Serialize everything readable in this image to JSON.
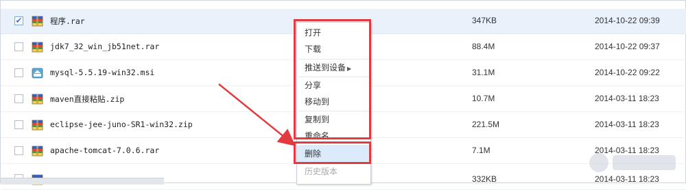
{
  "files": [
    {
      "name": "程序.rar",
      "size": "347KB",
      "date": "2014-10-22 09:39",
      "icon": "rar-archive-icon",
      "selected": true
    },
    {
      "name": "jdk7_32_win_jb51net.rar",
      "size": "88.4M",
      "date": "2014-10-22 09:37",
      "icon": "rar-archive-icon",
      "selected": false
    },
    {
      "name": "mysql-5.5.19-win32.msi",
      "size": "31.1M",
      "date": "2014-10-22 09:22",
      "icon": "msi-installer-icon",
      "selected": false
    },
    {
      "name": "maven直接粘贴.zip",
      "size": "10.7M",
      "date": "2014-03-11 18:23",
      "icon": "zip-archive-icon",
      "selected": false
    },
    {
      "name": "eclipse-jee-juno-SR1-win32.zip",
      "size": "221.5M",
      "date": "2014-03-11 18:23",
      "icon": "zip-archive-icon",
      "selected": false
    },
    {
      "name": "apache-tomcat-7.0.6.rar",
      "size": "7.1M",
      "date": "2014-03-11 18:23",
      "icon": "rar-archive-icon",
      "selected": false
    },
    {
      "name": "",
      "size": "332KB",
      "date": "2014-03-11 18:23",
      "icon": "rar-archive-icon",
      "selected": false
    }
  ],
  "context_menu": {
    "items": [
      {
        "label": "打开",
        "enabled": true
      },
      {
        "label": "下载",
        "enabled": true
      },
      {
        "label": "推送到设备",
        "enabled": true,
        "submenu": true
      },
      {
        "label": "分享",
        "enabled": true
      },
      {
        "label": "移动到",
        "enabled": true
      },
      {
        "label": "复制到",
        "enabled": true
      },
      {
        "label": "重命名",
        "enabled": true
      },
      {
        "label": "删除",
        "enabled": true,
        "highlighted": true
      },
      {
        "label": "历史版本",
        "enabled": false
      }
    ],
    "submenu_arrow": "▶"
  },
  "checkbox_mark": "✔",
  "colors": {
    "highlight_red": "#e23a3f",
    "selected_row": "#e9f1fb",
    "menu_hover": "#dcebfb",
    "checkbox_blue": "#3b7fd0"
  }
}
